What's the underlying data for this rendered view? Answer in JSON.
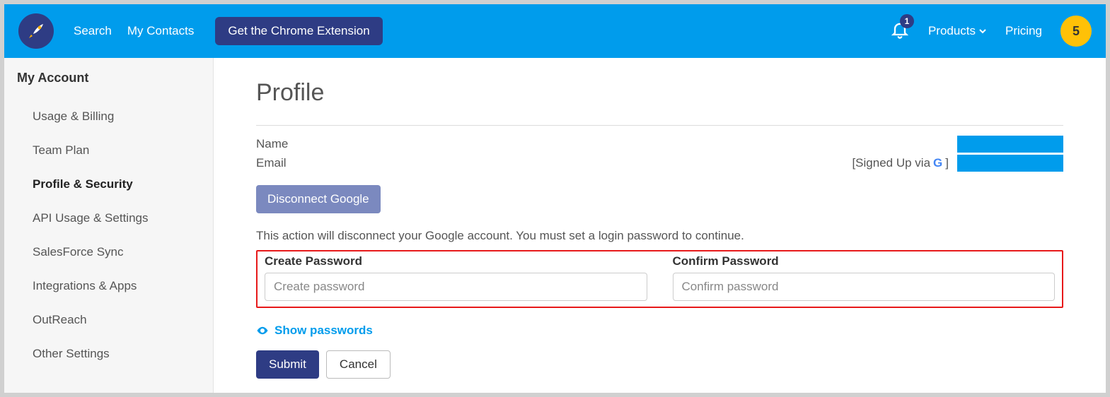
{
  "header": {
    "nav": {
      "search": "Search",
      "my_contacts": "My Contacts"
    },
    "chrome_ext": "Get the Chrome Extension",
    "notifications_count": "1",
    "products": "Products",
    "pricing": "Pricing",
    "avatar_badge": "5"
  },
  "sidebar": {
    "title": "My Account",
    "items": [
      "Usage & Billing",
      "Team Plan",
      "Profile & Security",
      "API Usage & Settings",
      "SalesForce Sync",
      "Integrations & Apps",
      "OutReach",
      "Other Settings"
    ],
    "active_index": 2
  },
  "main": {
    "title": "Profile",
    "name_label": "Name",
    "email_label": "Email",
    "signed_up_prefix": "[Signed Up via ",
    "signed_up_suffix": "]",
    "disconnect_btn": "Disconnect Google",
    "disconnect_info": "This action will disconnect your Google account. You must set a login password to continue.",
    "create_pw_label": "Create Password",
    "create_pw_placeholder": "Create password",
    "confirm_pw_label": "Confirm Password",
    "confirm_pw_placeholder": "Confirm password",
    "show_passwords": "Show passwords",
    "submit": "Submit",
    "cancel": "Cancel"
  }
}
